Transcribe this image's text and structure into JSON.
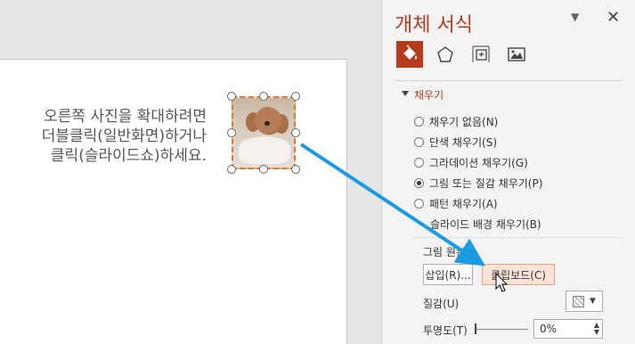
{
  "slide": {
    "instruction": "오른쪽 사진을 확대하려면\n더블클릭(일반화면)하거나\n클릭(슬라이드쇼)하세요."
  },
  "pane": {
    "title": "개체 서식",
    "dropdown_icon": "chevron-down-icon",
    "close_icon": "close-icon",
    "tabs": [
      {
        "name": "fill-line",
        "icon": "paint-bucket-icon",
        "active": true
      },
      {
        "name": "effects",
        "icon": "pentagon-icon",
        "active": false
      },
      {
        "name": "size-properties",
        "icon": "size-position-icon",
        "active": false
      },
      {
        "name": "picture",
        "icon": "picture-icon",
        "active": false
      }
    ],
    "fill_section": {
      "title": "채우기",
      "options": [
        {
          "label": "채우기 없음(N)",
          "checked": false,
          "disabled": false
        },
        {
          "label": "단색 채우기(S)",
          "checked": false,
          "disabled": false
        },
        {
          "label": "그라데이션 채우기(G)",
          "checked": false,
          "disabled": false
        },
        {
          "label": "그림 또는 질감 채우기(P)",
          "checked": true,
          "disabled": false
        },
        {
          "label": "패턴 채우기(A)",
          "checked": false,
          "disabled": false
        }
      ],
      "slide_bg_label": "슬라이드 배경 채우기(B)",
      "picture_source_label": "그림 원본",
      "insert_button": "삽입(R)...",
      "clipboard_button": "클립보드(C)",
      "texture_label": "질감(U)",
      "transparency_label": "투명도(T)",
      "transparency_value": "0%"
    }
  },
  "colors": {
    "accent": "#b33b20",
    "arrow": "#1a9ae0",
    "selection_dash": "#e07a2a"
  }
}
